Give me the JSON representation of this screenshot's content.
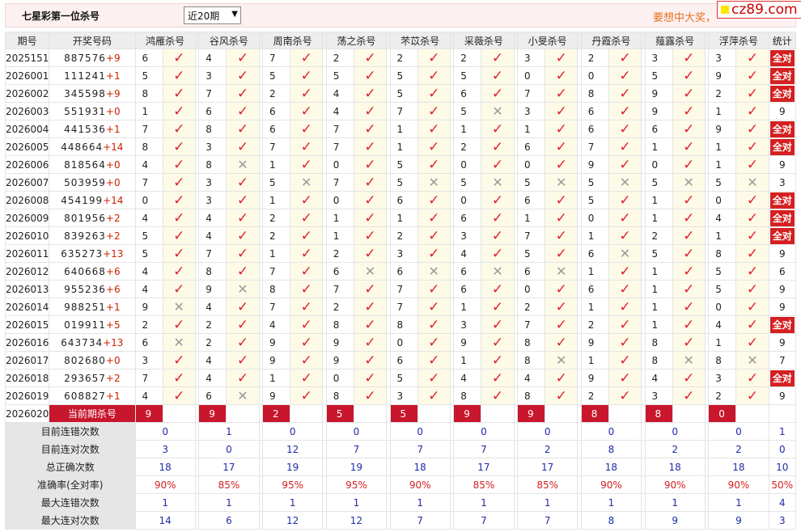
{
  "header": {
    "title": "七星彩第一位杀号",
    "period_select": "近20期",
    "promo": "要想中大奖，",
    "logo_text": "cz89.com"
  },
  "columns": {
    "issue": "期号",
    "numbers": "开奖号码",
    "experts": [
      "鸿雁杀号",
      "谷风杀号",
      "周南杀号",
      "荡之杀号",
      "芣苡杀号",
      "采薇杀号",
      "小旻杀号",
      "丹霞杀号",
      "薤露杀号",
      "浮萍杀号"
    ],
    "stats": "统计"
  },
  "rows": [
    {
      "issue": "2025151",
      "digits": "887576",
      "plus": "+9",
      "kills": [
        "6",
        "4",
        "7",
        "2",
        "2",
        "2",
        "3",
        "2",
        "3",
        "3"
      ],
      "ok": [
        1,
        1,
        1,
        1,
        1,
        1,
        1,
        1,
        1,
        1
      ],
      "stat": "全对"
    },
    {
      "issue": "2026001",
      "digits": "111241",
      "plus": "+1",
      "kills": [
        "5",
        "3",
        "5",
        "5",
        "5",
        "5",
        "0",
        "0",
        "5",
        "9"
      ],
      "ok": [
        1,
        1,
        1,
        1,
        1,
        1,
        1,
        1,
        1,
        1
      ],
      "stat": "全对"
    },
    {
      "issue": "2026002",
      "digits": "345598",
      "plus": "+9",
      "kills": [
        "8",
        "7",
        "2",
        "4",
        "5",
        "6",
        "7",
        "8",
        "9",
        "2"
      ],
      "ok": [
        1,
        1,
        1,
        1,
        1,
        1,
        1,
        1,
        1,
        1
      ],
      "stat": "全对"
    },
    {
      "issue": "2026003",
      "digits": "551931",
      "plus": "+0",
      "kills": [
        "1",
        "6",
        "6",
        "4",
        "7",
        "5",
        "3",
        "6",
        "9",
        "1"
      ],
      "ok": [
        1,
        1,
        1,
        1,
        1,
        0,
        1,
        1,
        1,
        1
      ],
      "stat": "9"
    },
    {
      "issue": "2026004",
      "digits": "441536",
      "plus": "+1",
      "kills": [
        "7",
        "8",
        "6",
        "7",
        "1",
        "1",
        "1",
        "6",
        "6",
        "9"
      ],
      "ok": [
        1,
        1,
        1,
        1,
        1,
        1,
        1,
        1,
        1,
        1
      ],
      "stat": "全对"
    },
    {
      "issue": "2026005",
      "digits": "448664",
      "plus": "+14",
      "kills": [
        "8",
        "3",
        "7",
        "7",
        "1",
        "2",
        "6",
        "7",
        "1",
        "1"
      ],
      "ok": [
        1,
        1,
        1,
        1,
        1,
        1,
        1,
        1,
        1,
        1
      ],
      "stat": "全对"
    },
    {
      "issue": "2026006",
      "digits": "818564",
      "plus": "+0",
      "kills": [
        "4",
        "8",
        "1",
        "0",
        "5",
        "0",
        "0",
        "9",
        "0",
        "1"
      ],
      "ok": [
        1,
        0,
        1,
        1,
        1,
        1,
        1,
        1,
        1,
        1
      ],
      "stat": "9"
    },
    {
      "issue": "2026007",
      "digits": "503959",
      "plus": "+0",
      "kills": [
        "7",
        "3",
        "5",
        "7",
        "5",
        "5",
        "5",
        "5",
        "5",
        "5"
      ],
      "ok": [
        1,
        1,
        0,
        1,
        0,
        0,
        0,
        0,
        0,
        0
      ],
      "stat": "3"
    },
    {
      "issue": "2026008",
      "digits": "454199",
      "plus": "+14",
      "kills": [
        "0",
        "3",
        "1",
        "0",
        "6",
        "0",
        "6",
        "5",
        "1",
        "0"
      ],
      "ok": [
        1,
        1,
        1,
        1,
        1,
        1,
        1,
        1,
        1,
        1
      ],
      "stat": "全对"
    },
    {
      "issue": "2026009",
      "digits": "801956",
      "plus": "+2",
      "kills": [
        "4",
        "4",
        "2",
        "1",
        "1",
        "6",
        "1",
        "0",
        "1",
        "4"
      ],
      "ok": [
        1,
        1,
        1,
        1,
        1,
        1,
        1,
        1,
        1,
        1
      ],
      "stat": "全对"
    },
    {
      "issue": "2026010",
      "digits": "839263",
      "plus": "+2",
      "kills": [
        "5",
        "4",
        "2",
        "1",
        "2",
        "3",
        "7",
        "1",
        "2",
        "1"
      ],
      "ok": [
        1,
        1,
        1,
        1,
        1,
        1,
        1,
        1,
        1,
        1
      ],
      "stat": "全对"
    },
    {
      "issue": "2026011",
      "digits": "635273",
      "plus": "+13",
      "kills": [
        "5",
        "7",
        "1",
        "2",
        "3",
        "4",
        "5",
        "6",
        "5",
        "8"
      ],
      "ok": [
        1,
        1,
        1,
        1,
        1,
        1,
        1,
        0,
        1,
        1
      ],
      "stat": "9"
    },
    {
      "issue": "2026012",
      "digits": "640668",
      "plus": "+6",
      "kills": [
        "4",
        "8",
        "7",
        "6",
        "6",
        "6",
        "6",
        "1",
        "1",
        "5"
      ],
      "ok": [
        1,
        1,
        1,
        0,
        0,
        0,
        0,
        1,
        1,
        1
      ],
      "stat": "6"
    },
    {
      "issue": "2026013",
      "digits": "955236",
      "plus": "+6",
      "kills": [
        "4",
        "9",
        "8",
        "7",
        "7",
        "6",
        "0",
        "6",
        "1",
        "5"
      ],
      "ok": [
        1,
        0,
        1,
        1,
        1,
        1,
        1,
        1,
        1,
        1
      ],
      "stat": "9"
    },
    {
      "issue": "2026014",
      "digits": "988251",
      "plus": "+1",
      "kills": [
        "9",
        "4",
        "7",
        "2",
        "7",
        "1",
        "2",
        "1",
        "1",
        "0"
      ],
      "ok": [
        0,
        1,
        1,
        1,
        1,
        1,
        1,
        1,
        1,
        1
      ],
      "stat": "9"
    },
    {
      "issue": "2026015",
      "digits": "019911",
      "plus": "+5",
      "kills": [
        "2",
        "2",
        "4",
        "8",
        "8",
        "3",
        "7",
        "2",
        "1",
        "4"
      ],
      "ok": [
        1,
        1,
        1,
        1,
        1,
        1,
        1,
        1,
        1,
        1
      ],
      "stat": "全对"
    },
    {
      "issue": "2026016",
      "digits": "643734",
      "plus": "+13",
      "kills": [
        "6",
        "2",
        "9",
        "9",
        "0",
        "9",
        "8",
        "9",
        "8",
        "1"
      ],
      "ok": [
        0,
        1,
        1,
        1,
        1,
        1,
        1,
        1,
        1,
        1
      ],
      "stat": "9"
    },
    {
      "issue": "2026017",
      "digits": "802680",
      "plus": "+0",
      "kills": [
        "3",
        "4",
        "9",
        "9",
        "6",
        "1",
        "8",
        "1",
        "8",
        "8"
      ],
      "ok": [
        1,
        1,
        1,
        1,
        1,
        1,
        0,
        1,
        0,
        0
      ],
      "stat": "7"
    },
    {
      "issue": "2026018",
      "digits": "293657",
      "plus": "+2",
      "kills": [
        "7",
        "4",
        "1",
        "0",
        "5",
        "4",
        "4",
        "9",
        "4",
        "3"
      ],
      "ok": [
        1,
        1,
        1,
        1,
        1,
        1,
        1,
        1,
        1,
        1
      ],
      "stat": "全对"
    },
    {
      "issue": "2026019",
      "digits": "608827",
      "plus": "+1",
      "kills": [
        "4",
        "6",
        "9",
        "8",
        "3",
        "8",
        "8",
        "2",
        "3",
        "2"
      ],
      "ok": [
        1,
        0,
        1,
        1,
        1,
        1,
        1,
        1,
        1,
        1
      ],
      "stat": "9"
    }
  ],
  "current": {
    "issue": "2026020",
    "label": "当前期杀号",
    "kills": [
      "9",
      "9",
      "2",
      "5",
      "5",
      "9",
      "9",
      "8",
      "8",
      "0"
    ]
  },
  "summary": [
    {
      "label": "目前连错次数",
      "values": [
        "0",
        "1",
        "0",
        "0",
        "0",
        "0",
        "0",
        "0",
        "0",
        "0"
      ],
      "stat": "1"
    },
    {
      "label": "目前连对次数",
      "values": [
        "3",
        "0",
        "12",
        "7",
        "7",
        "7",
        "2",
        "8",
        "2",
        "2"
      ],
      "stat": "0"
    },
    {
      "label": "总正确次数",
      "values": [
        "18",
        "17",
        "19",
        "19",
        "18",
        "17",
        "17",
        "18",
        "18",
        "18"
      ],
      "stat": "10"
    },
    {
      "label": "准确率(全对率)",
      "values": [
        "90%",
        "85%",
        "95%",
        "95%",
        "90%",
        "85%",
        "85%",
        "90%",
        "90%",
        "90%"
      ],
      "stat": "50%",
      "pct": true
    },
    {
      "label": "最大连错次数",
      "values": [
        "1",
        "1",
        "1",
        "1",
        "1",
        "1",
        "1",
        "1",
        "1",
        "1"
      ],
      "stat": "4"
    },
    {
      "label": "最大连对次数",
      "values": [
        "14",
        "6",
        "12",
        "12",
        "7",
        "7",
        "7",
        "8",
        "9",
        "9"
      ],
      "stat": "3"
    }
  ],
  "colors": {
    "check": "#e0212b",
    "cross": "#9a9a9a",
    "badge": "#d42020",
    "current_row": "#c8162c",
    "summary_value": "#1f2ca8"
  },
  "icons": {
    "correct": "check-mark-icon",
    "wrong": "cross-mark-icon"
  }
}
